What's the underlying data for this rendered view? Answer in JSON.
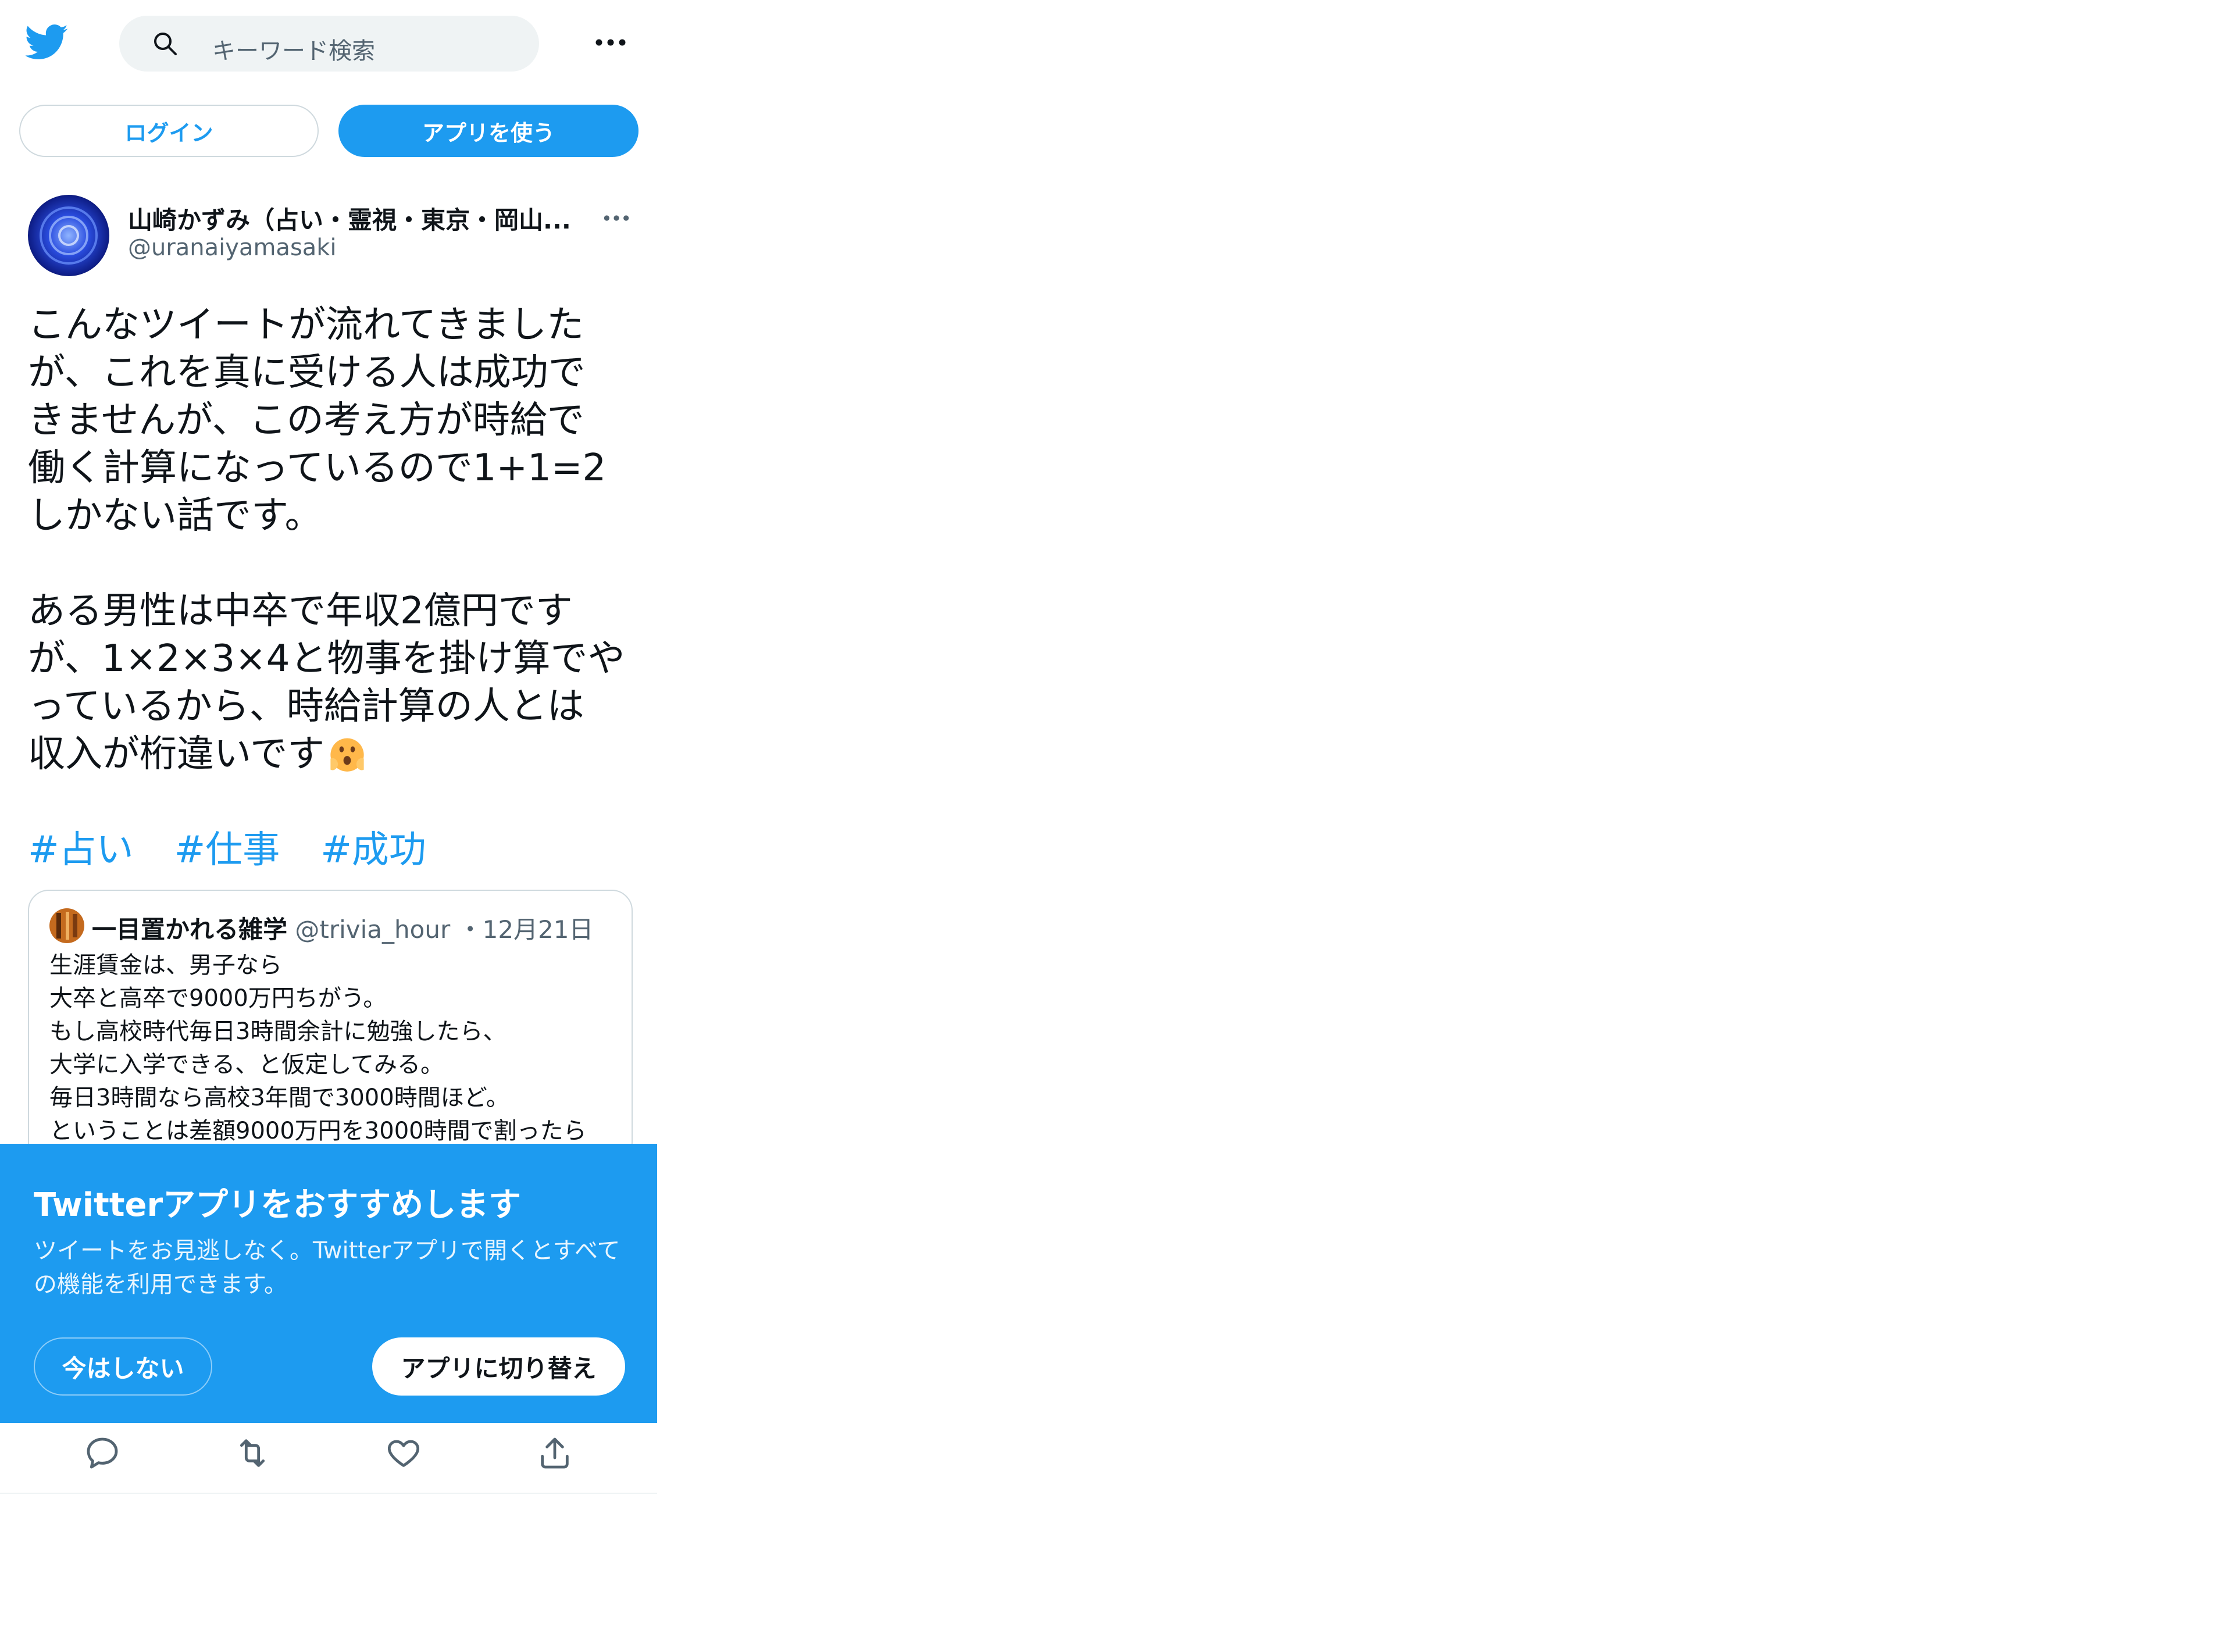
{
  "header": {
    "logo_icon": "twitter-bird-icon",
    "search_placeholder": "キーワード検索",
    "more_icon": "more-horizontal-icon"
  },
  "auth": {
    "login_label": "ログイン",
    "use_app_label": "アプリを使う"
  },
  "tweet": {
    "author_name": "山崎かずみ（占い・霊視・東京・岡山...",
    "author_handle": "@uranaiyamasaki",
    "text": "こんなツイートが流れてきました\nが、これを真に受ける人は成功で\nきませんが、この考え方が時給で\n働く計算になっているので1+1=2\nしかない話です。\n\nある男性は中卒で年収2億円です\nが、1×2×3×4と物事を掛け算でや\nっているから、時給計算の人とは\n収入が桁違いです",
    "hashtags": [
      "#占い",
      "#仕事",
      "#成功"
    ]
  },
  "quote": {
    "name": "一目置かれる雑学",
    "handle": "@trivia_hour",
    "date": "・12月21日",
    "text": "生涯賃金は、男子なら\n大卒と高卒で9000万円ちがう。\nもし高校時代毎日3時間余計に勉強したら、\n大学に入学できる、と仮定してみる。\n毎日3時間なら高校3年間で3000時間ほど。\nということは差額9000万円を3000時間で割ったら"
  },
  "promo": {
    "title": "Twitterアプリをおすすめします",
    "description": "ツイートをお見逃しなく。Twitterアプリで開くとすべての機能を利用できます。",
    "not_now_label": "今はしない",
    "switch_label": "アプリに切り替え"
  },
  "colors": {
    "brand": "#1d9bf0",
    "text": "#0f1419",
    "secondary": "#536471"
  }
}
